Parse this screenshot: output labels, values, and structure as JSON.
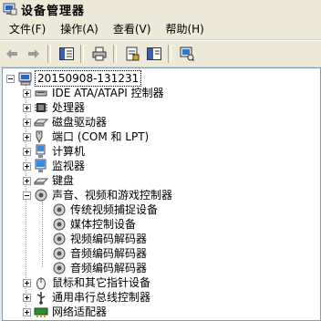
{
  "window": {
    "title": "设备管理器"
  },
  "menu": [
    "文件(F)",
    "操作(A)",
    "查看(V)",
    "帮助(H)"
  ],
  "toolbar": {
    "buttons": [
      "back-icon",
      "forward-icon",
      "show-hide-console-tree-icon",
      "print-icon",
      "properties-icon",
      "help-icon",
      "scan-hardware-icon"
    ]
  },
  "tree": {
    "root": "20150908-131231",
    "categories": [
      {
        "label": "IDE ATA/ATAPI 控制器",
        "icon": "ide-controller-icon",
        "expanded": false
      },
      {
        "label": "处理器",
        "icon": "processor-icon",
        "expanded": false
      },
      {
        "label": "磁盘驱动器",
        "icon": "disk-drive-icon",
        "expanded": false
      },
      {
        "label": "端口 (COM 和 LPT)",
        "icon": "port-icon",
        "expanded": false
      },
      {
        "label": "计算机",
        "icon": "computer-icon",
        "expanded": false
      },
      {
        "label": "监视器",
        "icon": "monitor-icon",
        "expanded": false
      },
      {
        "label": "键盘",
        "icon": "keyboard-icon",
        "expanded": false
      },
      {
        "label": "声音、视频和游戏控制器",
        "icon": "sound-icon",
        "expanded": true,
        "children": [
          "传统视频捕捉设备",
          "媒体控制设备",
          "视频编码解码器",
          "音频编码解码器",
          "音频编码解码器"
        ]
      },
      {
        "label": "鼠标和其它指针设备",
        "icon": "mouse-icon",
        "expanded": false
      },
      {
        "label": "通用串行总线控制器",
        "icon": "usb-icon",
        "expanded": false
      },
      {
        "label": "网络适配器",
        "icon": "network-adapter-icon",
        "expanded": false
      }
    ]
  }
}
